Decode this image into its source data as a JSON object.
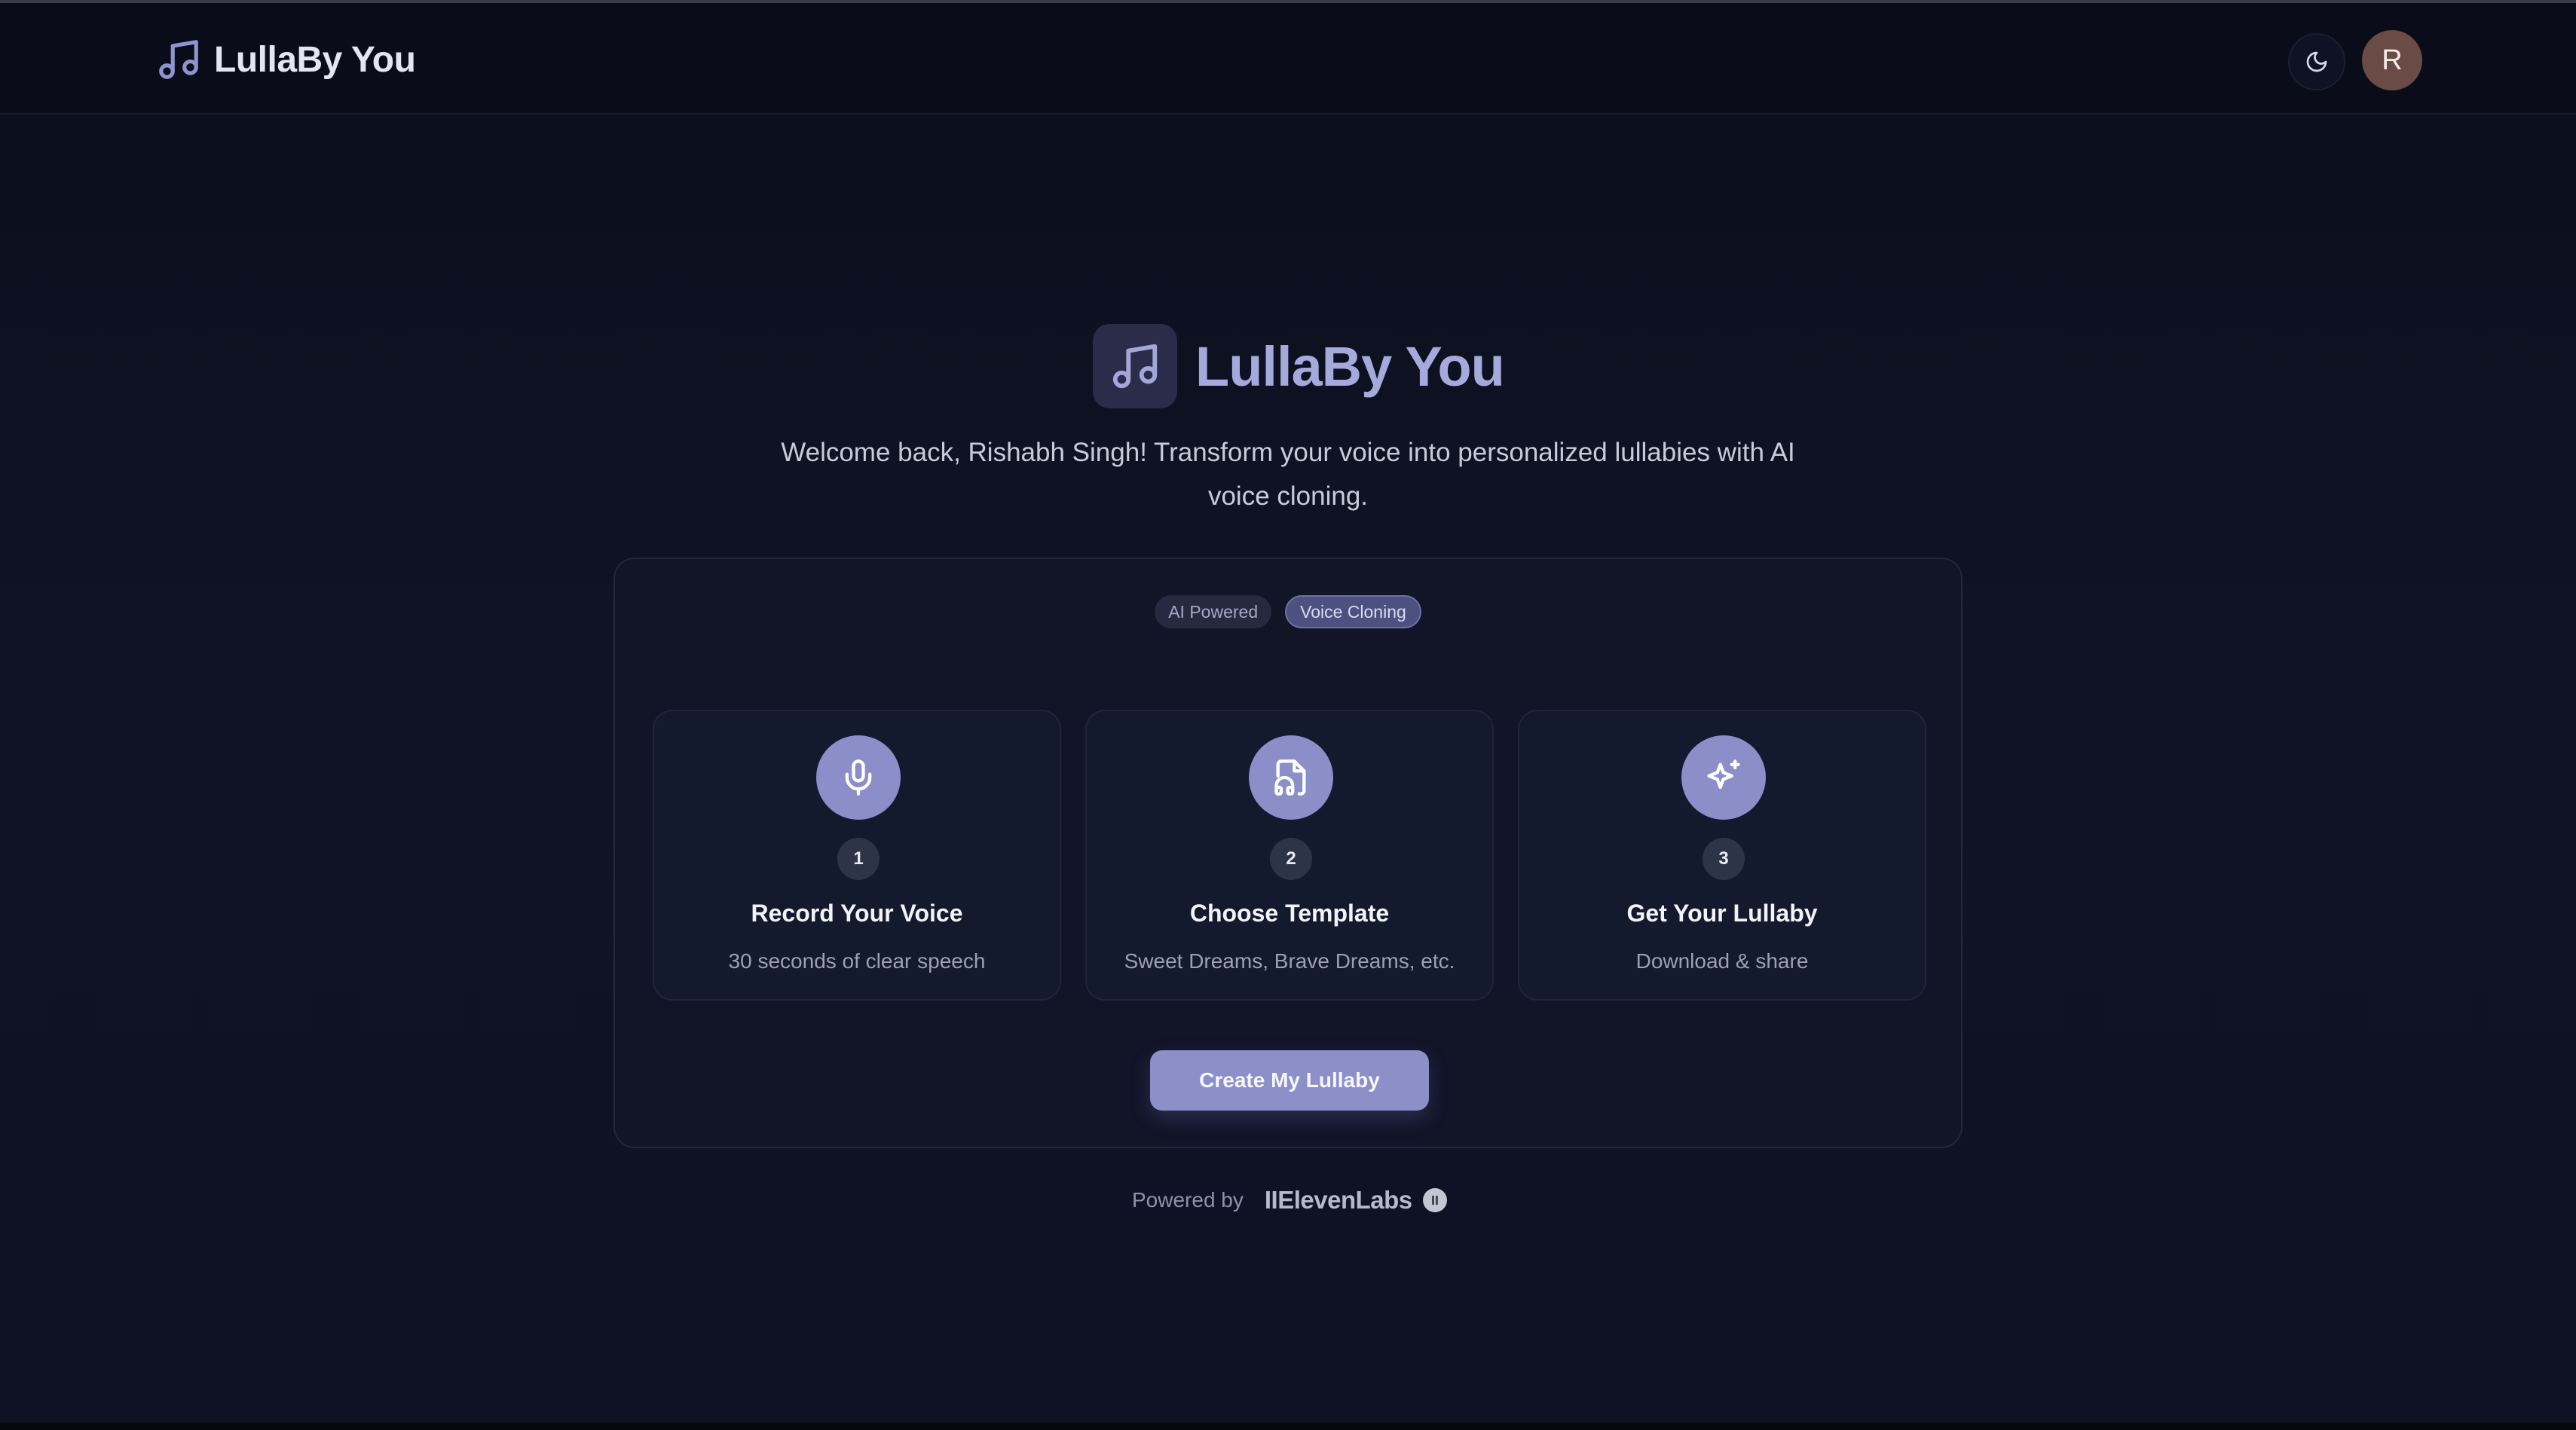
{
  "header": {
    "brand_name": "LullaBy You",
    "brand_icon": "music-note-icon",
    "theme_toggle_icon": "moon-icon",
    "avatar_initial": "R"
  },
  "hero": {
    "title": "LullaBy You",
    "icon": "music-note-icon",
    "subtitle": "Welcome back, Rishabh Singh! Transform your voice into personalized lullabies with AI voice cloning."
  },
  "badges": [
    "AI Powered",
    "Voice Cloning"
  ],
  "steps": [
    {
      "number": "1",
      "icon": "microphone-icon",
      "title": "Record Your Voice",
      "description": "30 seconds of clear speech"
    },
    {
      "number": "2",
      "icon": "audio-file-icon",
      "title": "Choose Template",
      "description": "Sweet Dreams, Brave Dreams, etc."
    },
    {
      "number": "3",
      "icon": "sparkles-icon",
      "title": "Get Your Lullaby",
      "description": "Download & share"
    }
  ],
  "cta_label": "Create My Lullaby",
  "footer": {
    "powered_label": "Powered by",
    "provider_name": "IIElevenLabs",
    "provider_badge_icon": "elevenlabs-badge-icon"
  },
  "colors": {
    "background": "#0d1020",
    "accent": "#8d90c8",
    "hero_title": "#a6a9dc",
    "avatar": "#6b4b45"
  }
}
